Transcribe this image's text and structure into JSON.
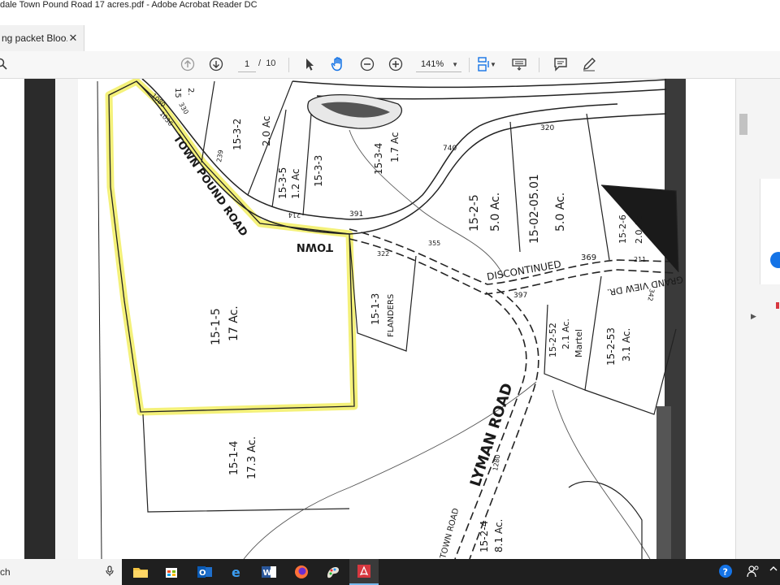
{
  "window": {
    "title": "dale Town Pound Road 17 acres.pdf - Adobe Acrobat Reader DC"
  },
  "tab": {
    "label": "ng packet Bloo...",
    "close": "✕"
  },
  "toolbar": {
    "page_current": "1",
    "page_sep": "/",
    "page_total": "10",
    "zoom": "141%",
    "icons": [
      "search-icon",
      "page-up-icon",
      "page-down-icon",
      "select-arrow-icon",
      "hand-tool-icon",
      "zoom-out-icon",
      "zoom-in-icon",
      "fit-page-icon",
      "keyboard-icon",
      "comment-icon",
      "pen-icon"
    ]
  },
  "map": {
    "road_town_pound_upper": "TOWN POUND ROAD",
    "road_town_pound_lower": "TOWN",
    "road_lyman": "LYMAN ROAD",
    "road_discontinued": "DISCONTINUED",
    "road_grandview": "GRAND VIEW DR.",
    "road_town_road": "TOWN ROAD",
    "parcels": {
      "p_15_1_5": "15-1-5",
      "p_15_1_5_ac": "17 Ac.",
      "p_15_1_4": "15-1-4",
      "p_15_1_4_ac": "17.3 Ac.",
      "p_15_1_3": "15-1-3",
      "p_15_1_3_owner": "FLANDERS",
      "p_15_3_2": "15-3-2",
      "p_15_3_2_ac": "2.0 Ac",
      "p_15_3_5": "15-3-5",
      "p_15_3_5_ac": "1.2 Ac",
      "p_15_3_3": "15-3-3",
      "p_15_3_4": "15-3-4",
      "p_15_3_4_ac": "1.7 Ac",
      "p_15_2_5": "15-2-5",
      "p_15_2_5_ac": "5.0 Ac.",
      "p_15_02_05_01": "15-02-05.01",
      "p_15_02_05_01_ac": "5.0 Ac.",
      "p_15_2_6": "15-2-6",
      "p_15_2_6_ac": "2.0 Ac",
      "p_15_2_52": "15-2-52",
      "p_15_2_52_ac": "2.1 Ac.",
      "p_15_2_52_owner": "Martel",
      "p_15_2_53": "15-2-53",
      "p_15_2_53_ac": "3.1 Ac.",
      "p_15_2_4": "15-2-4",
      "p_15_2_4_ac": "8.1 Ac."
    },
    "numbers": {
      "n320": "320",
      "n369": "369",
      "n397": "397",
      "n391": "391",
      "n740": "740",
      "n322": "322",
      "n355": "355",
      "n239": "239",
      "n211": "211",
      "n342": "342",
      "n1080": "1080",
      "n1036": "1036",
      "n330": "330",
      "n214": "214",
      "n1280": "1280",
      "n15": "15",
      "n2": "2."
    }
  },
  "taskbar": {
    "search_text": "ch",
    "apps": [
      "file-explorer-icon",
      "store-icon",
      "outlook-icon",
      "edge-icon",
      "word-icon",
      "firefox-icon",
      "paint-icon",
      "acrobat-icon"
    ]
  },
  "colors": {
    "highlight": "#f4f17a",
    "acrobat_red": "#d7373f",
    "accent_blue": "#1473e6"
  }
}
